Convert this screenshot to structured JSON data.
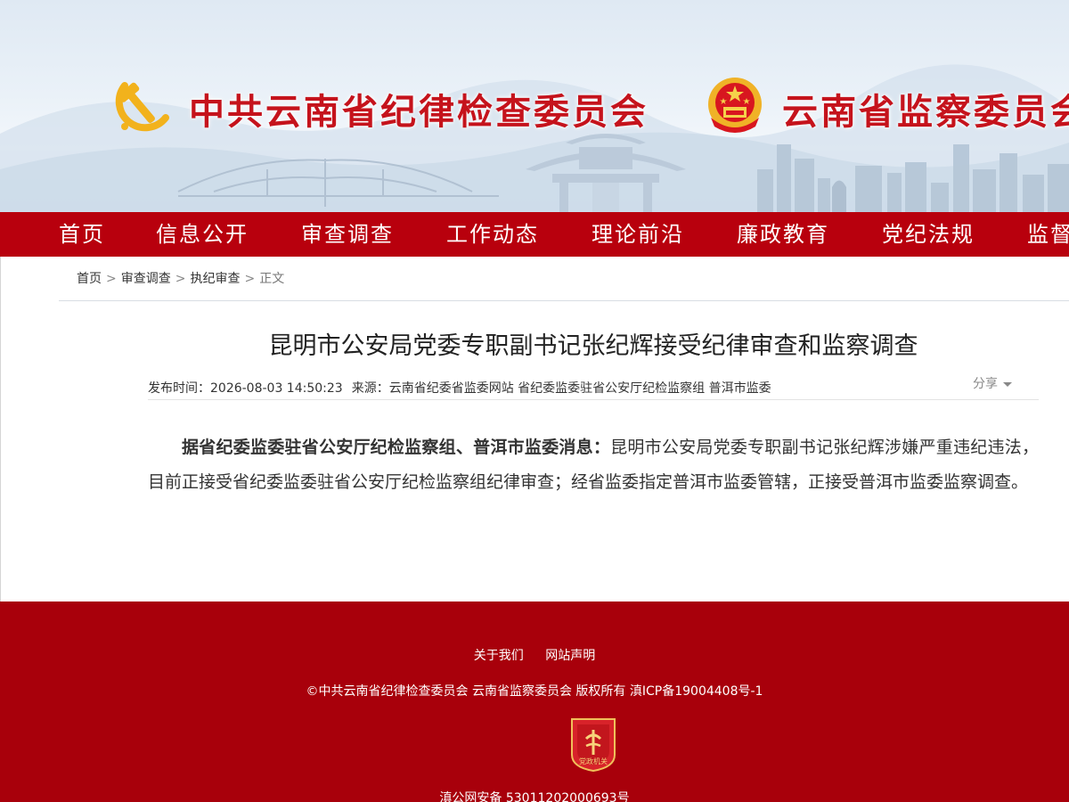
{
  "header": {
    "title_left": "中共云南省纪律检查委员会",
    "title_right": "云南省监察委员会",
    "left_icon": "party-emblem-icon",
    "right_icon": "national-emblem-icon"
  },
  "nav": {
    "items": [
      "首页",
      "信息公开",
      "审查调查",
      "工作动态",
      "理论前沿",
      "廉政教育",
      "党纪法规",
      "监督"
    ]
  },
  "breadcrumb": {
    "items": [
      "首页",
      "审查调查",
      "执纪审查"
    ],
    "current": "正文",
    "separator": ">"
  },
  "article": {
    "title": "昆明市公安局党委专职副书记张纪辉接受纪律审查和监察调查",
    "publish_label": "发布时间：",
    "publish_time": "2026-08-03 14:50:23",
    "source_label": "来源：",
    "source": "云南省纪委省监委网站 省纪委监委驻省公安厅纪检监察组 普洱市监委",
    "share_label": "分享",
    "lead_bold": "据省纪委监委驻省公安厅纪检监察组、普洱市监委消息：",
    "body": "昆明市公安局党委专职副书记张纪辉涉嫌严重违纪违法，目前正接受省纪委监委驻省公安厅纪检监察组纪律审查；经省监委指定普洱市监委管辖，正接受普洱市监委监察调查。"
  },
  "footer": {
    "links": [
      "关于我们",
      "网站声明"
    ],
    "copyright": "©中共云南省纪律检查委员会 云南省监察委员会 版权所有 滇ICP备19004408号-1",
    "badge_text": "党政机关",
    "badge_icon": "party-government-badge-icon",
    "police_record": "滇公网安备 53011202000693号"
  },
  "colors": {
    "brand_red": "#c5131c",
    "nav_bg": "#b8000d",
    "footer_bg": "#a8000b"
  }
}
